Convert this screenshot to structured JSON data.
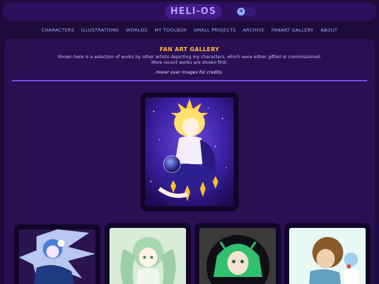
{
  "header": {
    "logo": "HELI-OS",
    "theme_toggle_icon": "sun-icon"
  },
  "nav": {
    "items": [
      {
        "label": "CHARACTERS"
      },
      {
        "label": "ILLUSTRATIONS"
      },
      {
        "label": "WORLDS"
      },
      {
        "label": "MY TOOLBOX"
      },
      {
        "label": "SMALL PROJECTS"
      },
      {
        "label": "ARCHIVE"
      },
      {
        "label": "FANART GALLERY"
      },
      {
        "label": "ABOUT"
      }
    ]
  },
  "gallery": {
    "title": "FAN ART GALLERY",
    "description_line1": "Shown here is a selection of works by other artists depicting my characters, which were either gifted or commissioned.",
    "description_line2": "More recent works are shown first.",
    "hint": "Hover over images for credits."
  },
  "colors": {
    "background": "#1e0b3a",
    "panel": "#2a0f55",
    "accent": "#ffb840",
    "nav": "#9fb0ff",
    "divider": "#7b4fe0"
  }
}
